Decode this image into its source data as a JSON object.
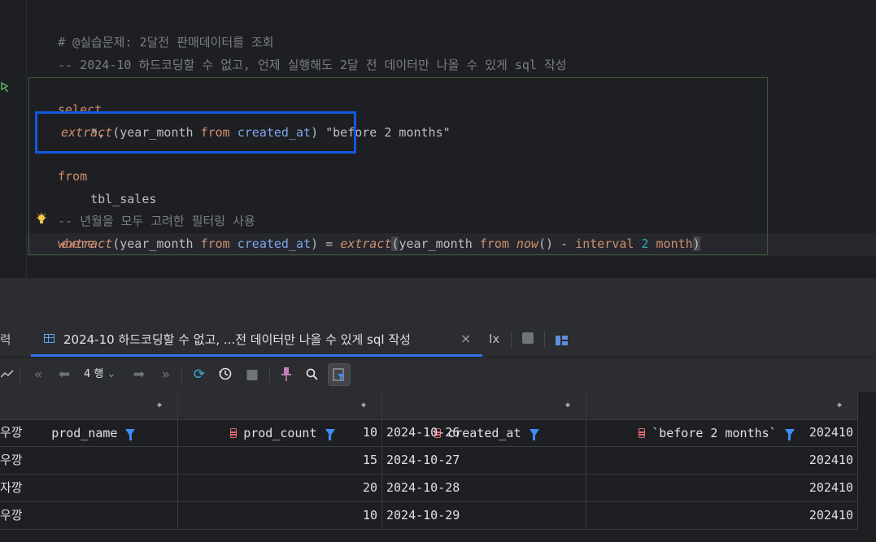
{
  "editor": {
    "lines": {
      "comment1": "# @실습문제: 2달전 판매데이터를 조회",
      "comment2": "-- 2024-10 하드코딩할 수 없고, 언제 실행해도 2달 전 데이터만 나올 수 있게 sql 작성",
      "select": "select",
      "star": "*,",
      "extract1_fn": "extract",
      "extract1_args_a": "(year_month ",
      "extract1_from": "from",
      "extract1_col": " created_at",
      "extract1_close": ") ",
      "alias": "\"before 2 months\"",
      "from": "from",
      "table": "tbl_sales",
      "comment3": "-- 년월을 모두 고려한 필터링 사용",
      "where": "where",
      "w_fn1": "extract",
      "w_open1": "(year_month ",
      "w_from1": "from",
      "w_col": " created_at",
      "w_eq": ") = ",
      "w_fn2": "extract",
      "w_open2": "(",
      "w_ym2": "year_month ",
      "w_from2": "from",
      "w_now": " now",
      "w_parens": "()",
      "w_minus": " - ",
      "w_interval": "interval",
      "w_num": " 2",
      "w_month": " month",
      "w_close": ")",
      "semicolon": ";"
    }
  },
  "tabbar": {
    "prev_tab_label": "출력",
    "active_tab_label": "2024-10 하드코딩할 수 없고, ...전 데이터만 나올 수 있게 sql 작성",
    "close_glyph": "×",
    "extra_label": "Ix"
  },
  "toolbar": {
    "rows_label": "4 행"
  },
  "grid": {
    "columns": [
      "prod_name",
      "prod_count",
      "created_at",
      "`before 2 months`"
    ],
    "rows": [
      [
        "우깡",
        "10",
        "2024-10-26",
        "202410"
      ],
      [
        "우깡",
        "15",
        "2024-10-27",
        "202410"
      ],
      [
        "자깡",
        "20",
        "2024-10-28",
        "202410"
      ],
      [
        "우깡",
        "10",
        "2024-10-29",
        "202410"
      ]
    ]
  },
  "icons": {
    "run": "run-gutter-icon",
    "bulb": "lightbulb-icon",
    "chart": "chart-icon",
    "first": "first-page-icon",
    "prev": "previous-page-icon",
    "next": "next-page-icon",
    "last": "last-page-icon",
    "refresh": "refresh-icon",
    "history": "history-icon",
    "stop": "stop-icon",
    "pin": "pin-icon",
    "search": "search-icon",
    "filter": "filter-icon"
  },
  "colors": {
    "background": "#1e1f22",
    "panel": "#2b2d30",
    "keyword": "#cf8e6d",
    "comment": "#7a7e85",
    "accent": "#3574f0",
    "highlight_box": "#1358e0"
  }
}
